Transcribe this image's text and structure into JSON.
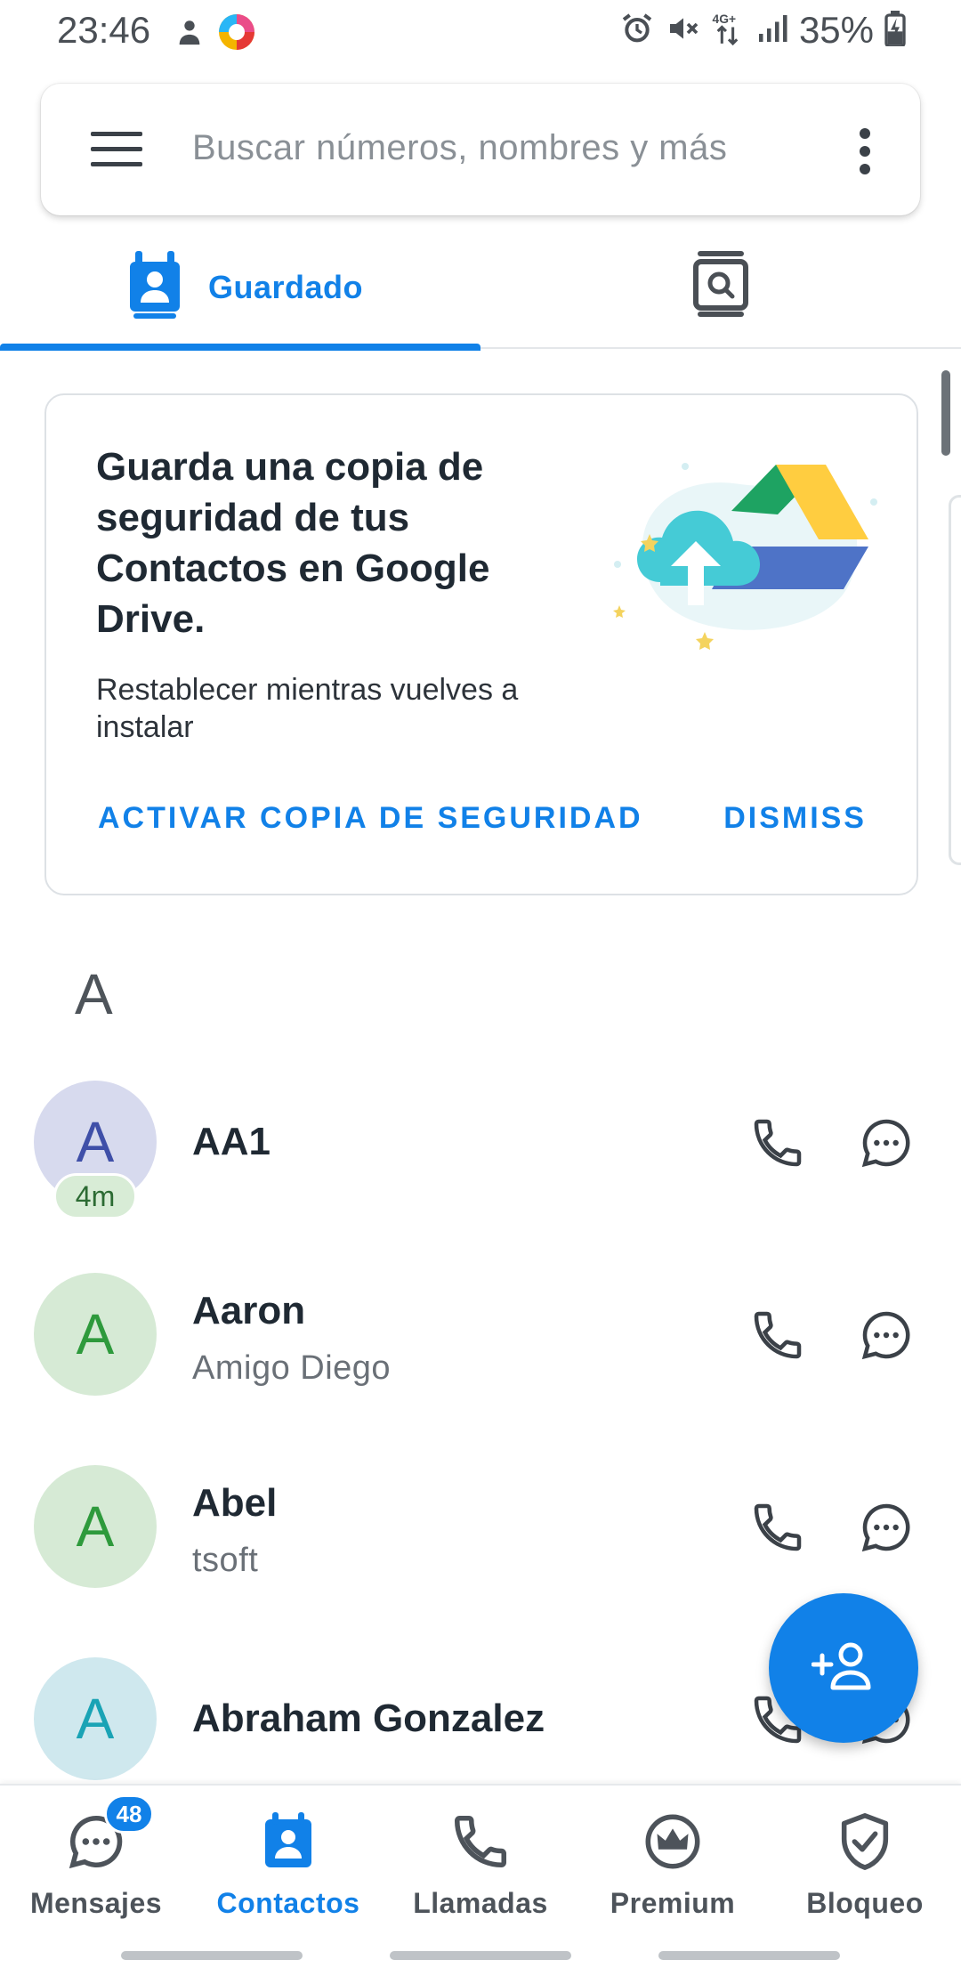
{
  "status_bar": {
    "time": "23:46",
    "network": "4G+",
    "battery": "35%",
    "icons": [
      "lock-person-icon",
      "app-colorful-icon",
      "alarm-icon",
      "mute-icon",
      "data-arrows-icon",
      "signal-icon",
      "battery-charging-icon"
    ]
  },
  "search": {
    "placeholder": "Buscar números, nombres y más"
  },
  "tabs": [
    {
      "label": "Guardado",
      "active": true,
      "icon": "contact-card-icon"
    },
    {
      "label": "",
      "active": false,
      "icon": "directory-search-icon"
    }
  ],
  "backup_card": {
    "title": "Guarda una copia de seguridad de tus Contactos en Google Drive.",
    "subtitle": "Restablecer mientras vuelves a instalar",
    "primary_action": "ACTIVAR COPIA DE SEGURIDAD",
    "dismiss_action": "DISMISS"
  },
  "section_letter": "A",
  "contacts": [
    {
      "initial": "A",
      "name": "AA1",
      "subtitle": "",
      "badge": "4m",
      "avatar_bg": "#d7daee",
      "avatar_fg": "#3f4fa8"
    },
    {
      "initial": "A",
      "name": "Aaron",
      "subtitle": "Amigo Diego",
      "badge": "",
      "avatar_bg": "#d6ead5",
      "avatar_fg": "#2e9a3c"
    },
    {
      "initial": "A",
      "name": "Abel",
      "subtitle": "tsoft",
      "badge": "",
      "avatar_bg": "#d6ead5",
      "avatar_fg": "#2e9a3c"
    },
    {
      "initial": "A",
      "name": "Abraham Gonzalez",
      "subtitle": "",
      "badge": "",
      "avatar_bg": "#cfe8ee",
      "avatar_fg": "#1aa3b5"
    }
  ],
  "bottom_nav": [
    {
      "label": "Mensajes",
      "icon": "chat-bubble-icon",
      "badge": "48",
      "active": false
    },
    {
      "label": "Contactos",
      "icon": "contact-card-icon",
      "badge": "",
      "active": true
    },
    {
      "label": "Llamadas",
      "icon": "phone-icon",
      "badge": "",
      "active": false
    },
    {
      "label": "Premium",
      "icon": "crown-icon",
      "badge": "",
      "active": false
    },
    {
      "label": "Bloqueo",
      "icon": "shield-check-icon",
      "badge": "",
      "active": false
    }
  ],
  "colors": {
    "accent": "#1181e8",
    "text_primary": "#1f2933",
    "text_secondary": "#6a7077"
  }
}
